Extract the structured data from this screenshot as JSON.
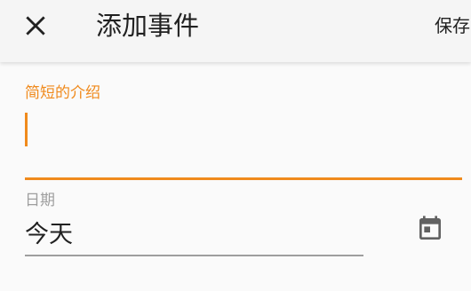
{
  "toolbar": {
    "title": "添加事件",
    "save_label": "保存",
    "close_icon": "close-icon"
  },
  "form": {
    "description": {
      "label": "简短的介绍",
      "value": "",
      "placeholder": ""
    },
    "date": {
      "label": "日期",
      "value": "今天",
      "picker_icon": "calendar-icon"
    }
  },
  "colors": {
    "accent": "#f08a1c",
    "toolbar_bg": "#f5f5f5",
    "page_bg": "#fafafa",
    "text_primary": "#212121",
    "text_secondary": "#9e9e9e",
    "icon": "#616161"
  }
}
